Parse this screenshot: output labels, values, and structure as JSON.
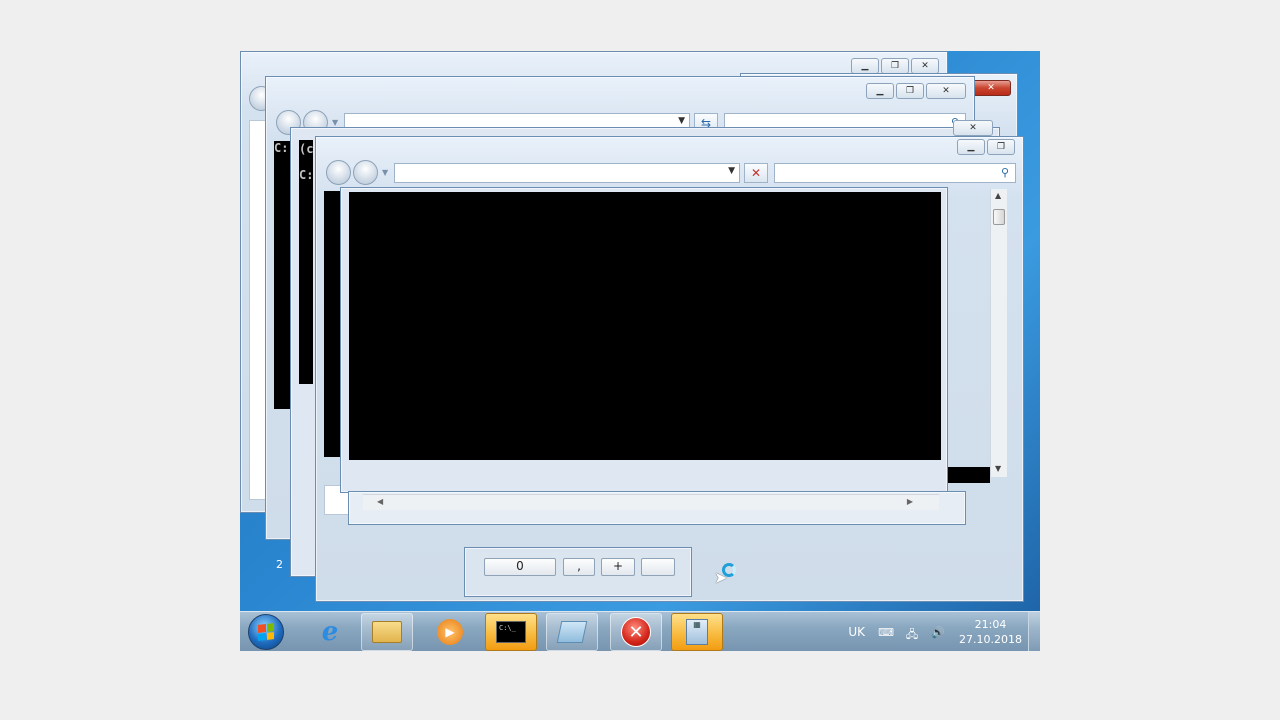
{
  "console": {
    "prompt_1": "C:",
    "prompt_2": "C:",
    "prompt_3": "(c"
  },
  "calculator": {
    "key_zero": "0",
    "key_comma": ",",
    "key_plus": "+",
    "badge": "2"
  },
  "taskbar": {
    "apps": [
      {
        "name": "Internet Explorer"
      },
      {
        "name": "Windows Explorer"
      },
      {
        "name": "Windows Media Player"
      },
      {
        "name": "Command Prompt"
      },
      {
        "name": "Notepad"
      },
      {
        "name": "Error"
      },
      {
        "name": "Calculator"
      }
    ],
    "tray": {
      "language": "UK",
      "time": "21:04",
      "date": "27.10.2018"
    }
  },
  "colors": {
    "desktop": "#2a86d0",
    "taskbar": "#8aa7c0",
    "active_button": "#f7b83b",
    "close_red": "#c9452f"
  }
}
